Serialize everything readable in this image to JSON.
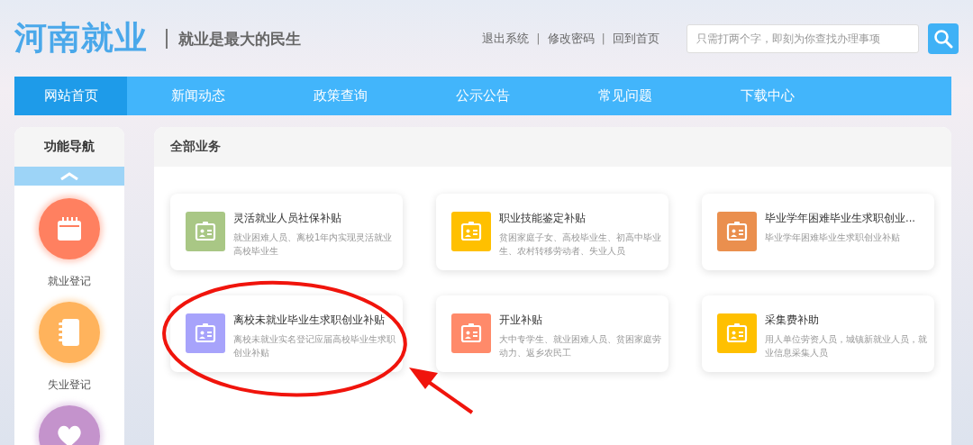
{
  "header": {
    "logo": "河南就业",
    "slogan": "就业是最大的民生",
    "links": [
      "退出系统",
      "修改密码",
      "回到首页"
    ],
    "separator": "|",
    "search": {
      "placeholder": "只需打两个字，即刻为你查找办理事项"
    }
  },
  "nav": [
    {
      "label": "网站首页",
      "selected": true
    },
    {
      "label": "新闻动态",
      "selected": false
    },
    {
      "label": "政策查询",
      "selected": false
    },
    {
      "label": "公示公告",
      "selected": false
    },
    {
      "label": "常见问题",
      "selected": false
    },
    {
      "label": "下载中心",
      "selected": false
    }
  ],
  "sidebar": {
    "title": "功能导航",
    "items": [
      {
        "label": "就业登记",
        "color": "#ff8060",
        "kind": "calendar"
      },
      {
        "label": "失业登记",
        "color": "#ffb35c",
        "kind": "notebook"
      },
      {
        "color": "#c493cc",
        "kind": "heart"
      }
    ]
  },
  "panel": {
    "title": "全部业务",
    "cards": [
      {
        "title": "灵活就业人员社保补贴",
        "desc": "就业困难人员、离校1年内实现灵活就业高校毕业生",
        "color": "#a9c785"
      },
      {
        "title": "职业技能鉴定补贴",
        "desc": "贫困家庭子女、高校毕业生、初高中毕业生、农村转移劳动者、失业人员",
        "color": "#ffc000"
      },
      {
        "title": "毕业学年困难毕业生求职创业...",
        "desc": "毕业学年困难毕业生求职创业补贴",
        "color": "#ea8f4e"
      },
      {
        "title": "离校未就业毕业生求职创业补贴",
        "desc": "离校未就业实名登记应届高校毕业生求职创业补贴",
        "color": "#a7a3fb"
      },
      {
        "title": "开业补贴",
        "desc": "大中专学生、就业困难人员、贫困家庭劳动力、返乡农民工",
        "color": "#ff8a6a"
      },
      {
        "title": "采集费补助",
        "desc": "用人单位劳资人员，城镇新就业人员，就业信息采集人员",
        "color": "#ffc000"
      }
    ]
  }
}
